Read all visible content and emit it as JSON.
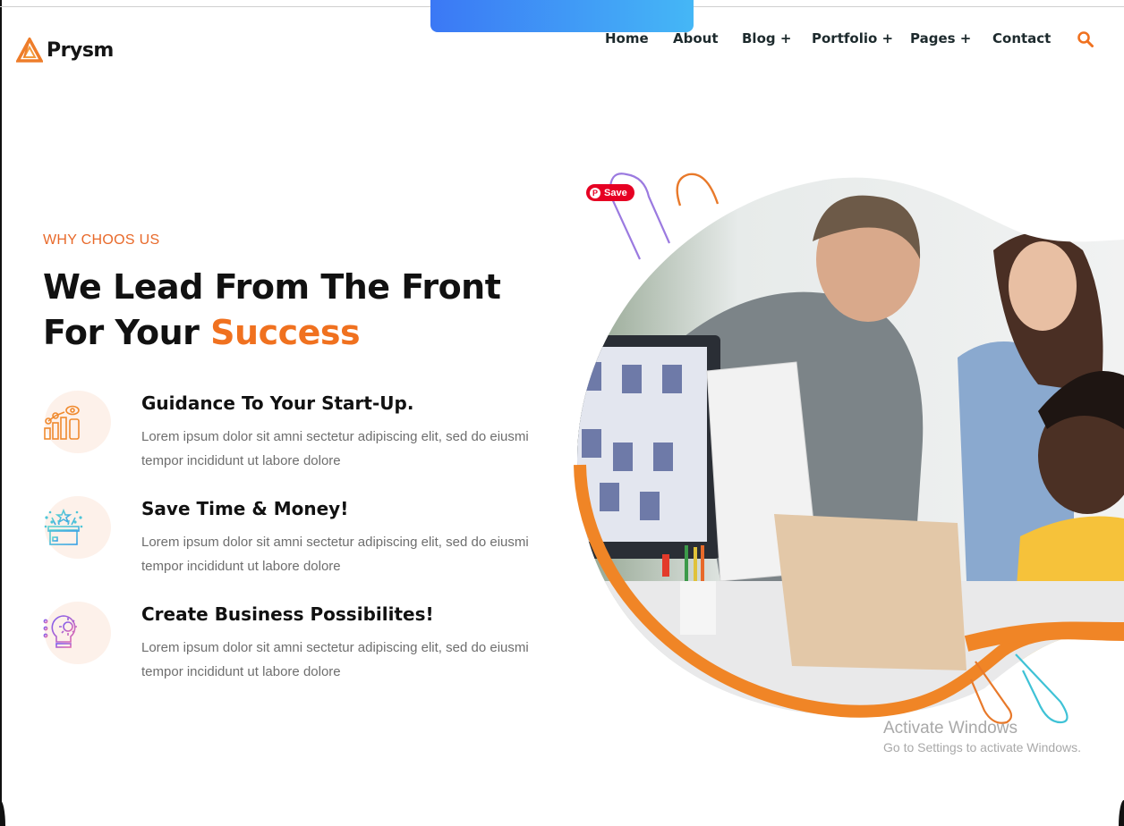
{
  "brand": {
    "name": "Prysm",
    "accent_color": "#f0711f"
  },
  "nav": {
    "items": [
      {
        "label": "Home"
      },
      {
        "label": "About"
      },
      {
        "label": "Blog +"
      },
      {
        "label": "Portfolio +"
      },
      {
        "label": "Pages +"
      },
      {
        "label": "Contact"
      }
    ],
    "search_icon": "search-icon"
  },
  "hero": {
    "eyebrow": "WHY CHOOS US",
    "headline_line1": "We Lead From The Front",
    "headline_line2_prefix": "For Your ",
    "headline_line2_accent": "Success",
    "image_alt": "Three colleagues looking at a laptop and monitor in an office",
    "pinterest_save_label": "Save"
  },
  "features": [
    {
      "icon": "growth-chart-icon",
      "title": "Guidance To Your Start-Up.",
      "desc": "Lorem ipsum dolor sit amni sectetur adipiscing elit, sed do eiusmi tempor incididunt ut labore dolore"
    },
    {
      "icon": "gift-box-icon",
      "title": "Save Time & Money!",
      "desc": "Lorem ipsum dolor sit amni sectetur adipiscing elit, sed do eiusmi tempor incididunt ut labore dolore"
    },
    {
      "icon": "idea-bulb-gear-icon",
      "title": "Create Business Possibilites!",
      "desc": "Lorem ipsum dolor sit amni sectetur adipiscing elit, sed do eiusmi tempor incididunt ut labore dolore"
    }
  ],
  "watermark": {
    "line1": "Activate Windows",
    "line2": "Go to Settings to activate Windows."
  }
}
